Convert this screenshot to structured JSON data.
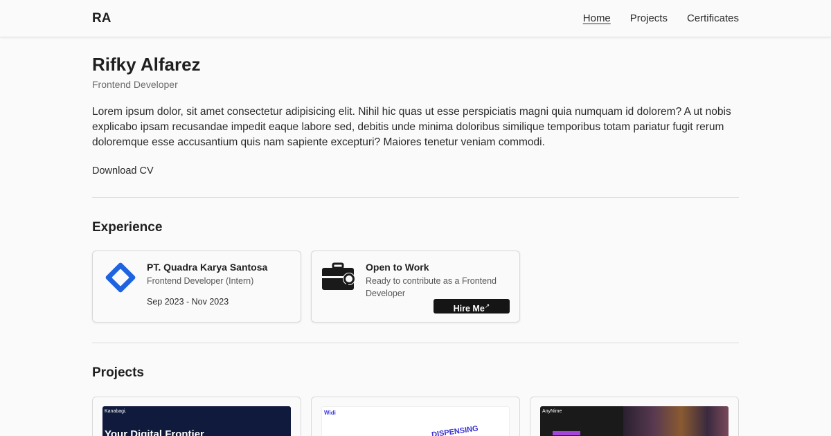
{
  "nav": {
    "logo": "RA",
    "links": [
      {
        "label": "Home",
        "active": true
      },
      {
        "label": "Projects",
        "active": false
      },
      {
        "label": "Certificates",
        "active": false
      }
    ]
  },
  "hero": {
    "name": "Rifky Alfarez",
    "role": "Frontend Developer",
    "bio": "Lorem ipsum dolor, sit amet consectetur adipisicing elit. Nihil hic quas ut esse perspiciatis magni quia numquam id dolorem? A ut nobis explicabo ipsam recusandae impedit eaque labore sed, debitis unde minima doloribus similique temporibus totam pariatur fugit rerum doloremque esse accusantium quis nam sapiente excepturi? Maiores tenetur veniam commodi.",
    "cv_label": "Download CV"
  },
  "experience": {
    "title": "Experience",
    "items": [
      {
        "company": "PT. Quadra Karya Santosa",
        "position": "Frontend Developer (Intern)",
        "period": "Sep 2023 - Nov 2023",
        "icon": "diamond-logo-icon"
      },
      {
        "title": "Open to Work",
        "description": "Ready to contribute as a Frontend Developer",
        "button": "Hire Me",
        "icon": "briefcase-search-icon"
      }
    ]
  },
  "projects": {
    "title": "Projects",
    "thumbs": [
      {
        "brand": "Kanabagi.",
        "headline": "Your Digital Frontier"
      },
      {
        "brand": "Widi",
        "headline": "DISPENSING"
      },
      {
        "brand": "AnyNime"
      }
    ]
  },
  "colors": {
    "background": "#fafafa",
    "text": "#1f1f1f",
    "muted": "#6b6b6b",
    "accent_blue": "#1e63e0",
    "button": "#151515"
  }
}
